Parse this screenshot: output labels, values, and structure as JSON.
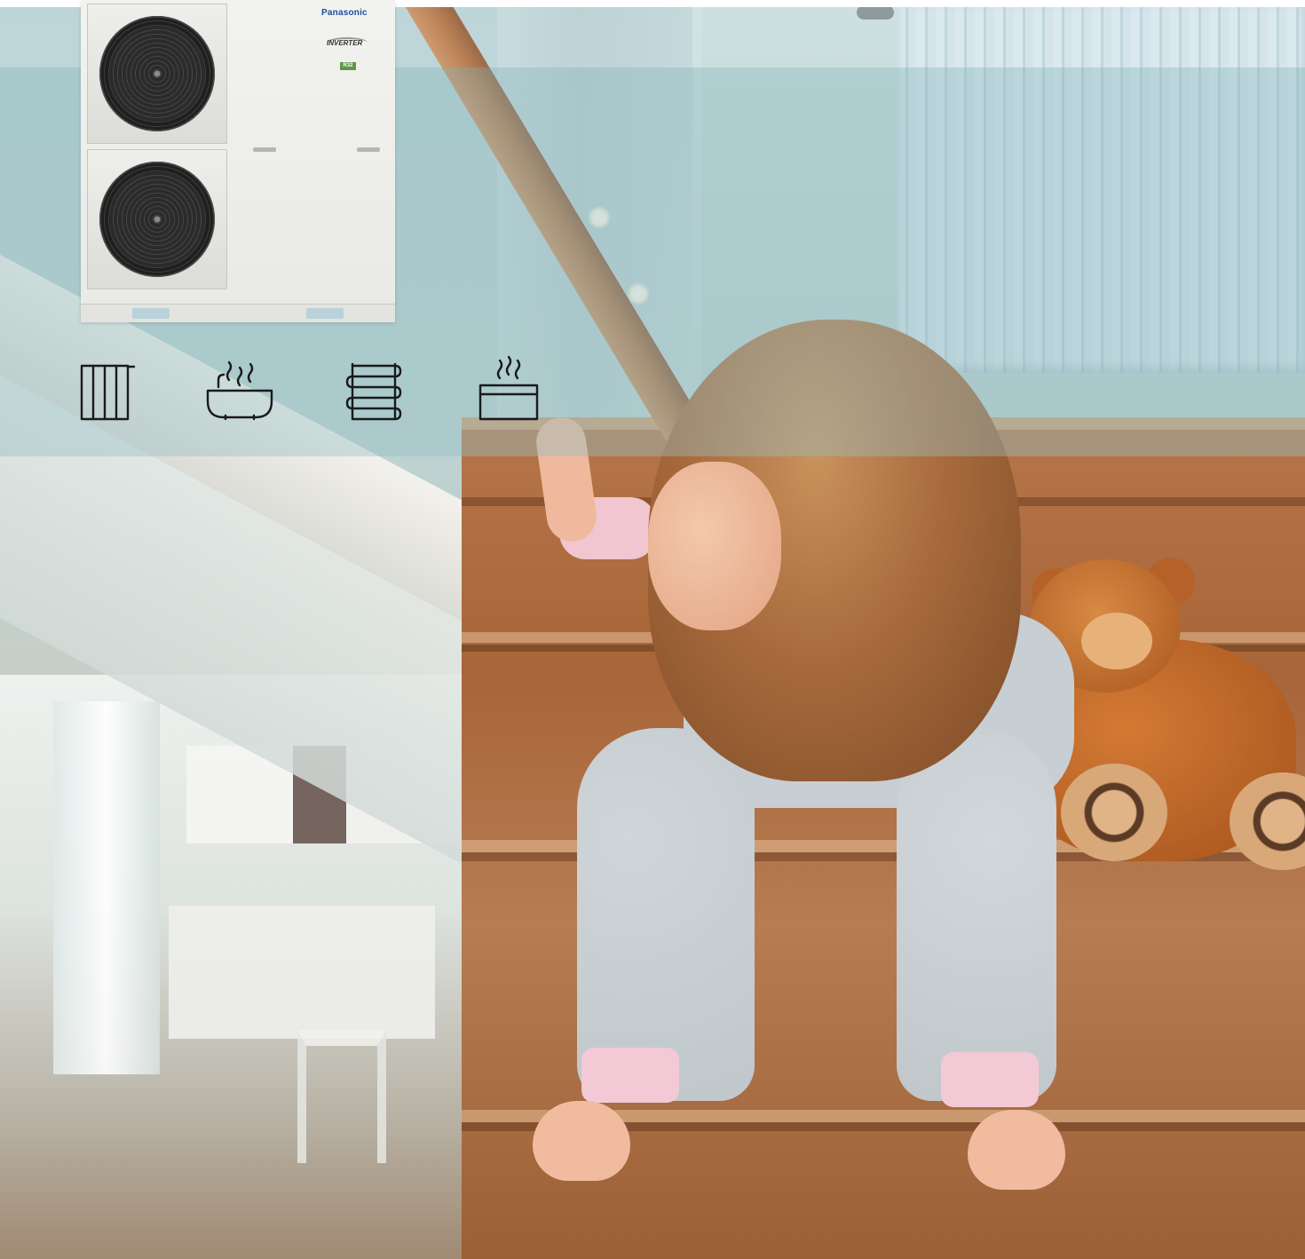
{
  "product": {
    "brand": "Panasonic",
    "series_badge": "INVERTER",
    "eco_badge": "R32"
  },
  "icons": [
    {
      "name": "radiator-icon",
      "meaning": "radiator heating"
    },
    {
      "name": "hot-bath-icon",
      "meaning": "domestic hot water"
    },
    {
      "name": "underfloor-heating-icon",
      "meaning": "underfloor heating"
    },
    {
      "name": "hot-water-tank-icon",
      "meaning": "hot water tank"
    }
  ],
  "colors": {
    "overlay": "#96bec4",
    "icon_stroke": "#1a1a1a",
    "brand_blue": "#1e4fa0"
  }
}
